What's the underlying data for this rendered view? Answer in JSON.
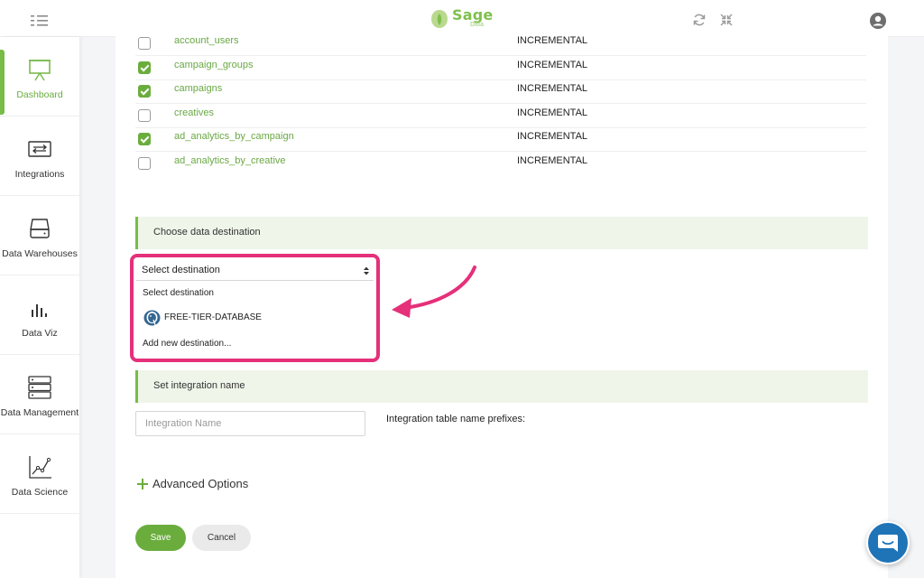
{
  "app": {
    "logo_text": "Sage",
    "logo_subtext": "Data",
    "brand_color": "#78bc47",
    "accent_color": "#e5307a"
  },
  "topbar": {
    "icons": [
      "menu-icon",
      "refresh-icon",
      "collapse-icon",
      "user-icon"
    ]
  },
  "sidebar": {
    "items": [
      {
        "label": "Dashboard",
        "icon": "presentation-board-icon",
        "active": true
      },
      {
        "label": "Integrations",
        "icon": "swap-arrows-icon",
        "active": false
      },
      {
        "label": "Data Warehouses",
        "icon": "hard-drive-icon",
        "active": false
      },
      {
        "label": "Data Viz",
        "icon": "bar-chart-icon",
        "active": false
      },
      {
        "label": "Data Management",
        "icon": "server-stack-icon",
        "active": false
      },
      {
        "label": "Data Science",
        "icon": "line-chart-icon",
        "active": false
      }
    ]
  },
  "streams": [
    {
      "name": "account_users",
      "method": "INCREMENTAL",
      "checked": false
    },
    {
      "name": "campaign_groups",
      "method": "INCREMENTAL",
      "checked": true
    },
    {
      "name": "campaigns",
      "method": "INCREMENTAL",
      "checked": true
    },
    {
      "name": "creatives",
      "method": "INCREMENTAL",
      "checked": false
    },
    {
      "name": "ad_analytics_by_campaign",
      "method": "INCREMENTAL",
      "checked": true
    },
    {
      "name": "ad_analytics_by_creative",
      "method": "INCREMENTAL",
      "checked": false
    }
  ],
  "destination": {
    "section_title": "Choose data destination",
    "selected": "Select destination",
    "options": [
      {
        "label": "Select destination"
      },
      {
        "label": "FREE-TIER-DATABASE",
        "icon": "postgresql-icon"
      },
      {
        "label": "Add new destination..."
      }
    ]
  },
  "integration_name": {
    "section_title": "Set integration name",
    "placeholder": "Integration Name",
    "value": "",
    "prefix_label": "Integration table name prefixes:"
  },
  "advanced_options_label": "Advanced Options",
  "buttons": {
    "save": "Save",
    "cancel": "Cancel"
  },
  "chat": {
    "icon": "chat-bubble-icon"
  }
}
